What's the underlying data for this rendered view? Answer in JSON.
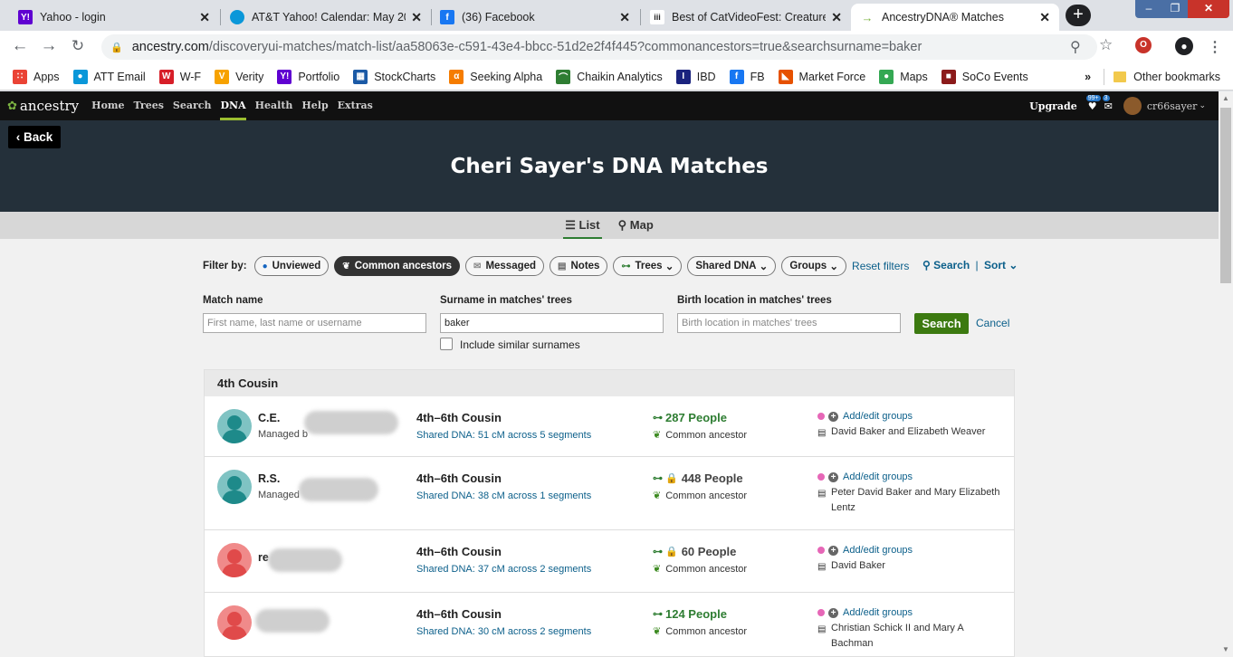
{
  "browser": {
    "tabs": [
      {
        "title": "Yahoo - login",
        "fav": "Y!",
        "fav_color": "#5f01d1"
      },
      {
        "title": "AT&T Yahoo! Calendar: May 202",
        "fav": "●",
        "fav_color": "#0a97d9"
      },
      {
        "title": "(36) Facebook",
        "fav": "f",
        "fav_color": "#1877f2"
      },
      {
        "title": "Best of CatVideoFest: Creature C",
        "fav": "iii",
        "fav_color": "#222"
      },
      {
        "title": "AncestryDNA® Matches",
        "fav": "→",
        "fav_color": "#7cb342"
      }
    ],
    "url_domain": "ancestry.com",
    "url_path": "/discoveryui-matches/match-list/aa58063e-c591-43e4-bbcc-51d2e2f4f445?commonancestors=true&searchsurname=baker",
    "bookmarks": [
      {
        "label": "Apps",
        "icon": "apps-icon",
        "color": "#ea4335",
        "glyph": "∷"
      },
      {
        "label": "ATT Email",
        "icon": "att-globe-icon",
        "color": "#0a97d9",
        "glyph": "●"
      },
      {
        "label": "W-F",
        "icon": "wells-fargo-icon",
        "color": "#d71e28",
        "glyph": "W"
      },
      {
        "label": "Verity",
        "icon": "verity-icon",
        "color": "#f7a200",
        "glyph": "V"
      },
      {
        "label": "Portfolio",
        "icon": "yahoo-icon",
        "color": "#5f01d1",
        "glyph": "Y!"
      },
      {
        "label": "StockCharts",
        "icon": "stockcharts-icon",
        "color": "#1b5aa6",
        "glyph": "▦"
      },
      {
        "label": "Seeking Alpha",
        "icon": "seeking-alpha-icon",
        "color": "#f57c00",
        "glyph": "α"
      },
      {
        "label": "Chaikin Analytics",
        "icon": "chaikin-icon",
        "color": "#2e7d32",
        "glyph": "⌒"
      },
      {
        "label": "IBD",
        "icon": "ibd-icon",
        "color": "#1a237e",
        "glyph": "I"
      },
      {
        "label": "FB",
        "icon": "facebook-icon",
        "color": "#1877f2",
        "glyph": "f"
      },
      {
        "label": "Market Force",
        "icon": "market-force-icon",
        "color": "#e65100",
        "glyph": "◣"
      },
      {
        "label": "Maps",
        "icon": "maps-pin-icon",
        "color": "#34a853",
        "glyph": "●"
      },
      {
        "label": "SoCo Events",
        "icon": "soco-icon",
        "color": "#8b1a1a",
        "glyph": "■"
      }
    ],
    "other_bookmarks": "Other bookmarks",
    "more_chevrons": "»"
  },
  "site": {
    "nav": [
      "Home",
      "Trees",
      "Search",
      "DNA",
      "Health",
      "Help",
      "Extras"
    ],
    "logo": "ancestry",
    "upgrade": "Upgrade",
    "badge_hints": "99+",
    "badge_messages": "3",
    "username": "cr66sayer",
    "back": "Back",
    "title": "Cheri Sayer's DNA Matches",
    "view_list": "List",
    "view_map": "Map"
  },
  "filters": {
    "label": "Filter by:",
    "chips": [
      "Unviewed",
      "Common ancestors",
      "Messaged",
      "Notes",
      "Trees",
      "Shared DNA",
      "Groups"
    ],
    "reset": "Reset filters",
    "search": "Search",
    "sort": "Sort",
    "divider": "|"
  },
  "form": {
    "match_name_label": "Match name",
    "match_name_placeholder": "First name, last name or username",
    "surname_label": "Surname in matches' trees",
    "surname_value": "baker",
    "birth_label": "Birth location in matches' trees",
    "birth_placeholder": "Birth location in matches' trees",
    "similar": "Include similar surnames",
    "search_btn": "Search",
    "cancel": "Cancel"
  },
  "group_title": "4th Cousin",
  "matches": [
    {
      "name": "C.E.",
      "managed": "Managed b",
      "avatar": "teal",
      "relationship": "4th–6th Cousin",
      "shared": "Shared DNA: 51 cM across 5 segments",
      "people": "287 People",
      "locked": false,
      "common": "Common ancestor",
      "groups": "Add/edit groups",
      "ancestors": "David Baker and Elizabeth Weaver"
    },
    {
      "name": "R.S.",
      "managed": "Managed",
      "avatar": "teal",
      "relationship": "4th–6th Cousin",
      "shared": "Shared DNA: 38 cM across 1 segments",
      "people": "448 People",
      "locked": true,
      "common": "Common ancestor",
      "groups": "Add/edit groups",
      "ancestors": "Peter David Baker and Mary Elizabeth Lentz"
    },
    {
      "name": "re",
      "managed": "",
      "avatar": "red",
      "relationship": "4th–6th Cousin",
      "shared": "Shared DNA: 37 cM across 2 segments",
      "people": "60 People",
      "locked": true,
      "common": "Common ancestor",
      "groups": "Add/edit groups",
      "ancestors": "David Baker"
    },
    {
      "name": "",
      "managed": "",
      "avatar": "red",
      "relationship": "4th–6th Cousin",
      "shared": "Shared DNA: 30 cM across 2 segments",
      "people": "124 People",
      "locked": false,
      "common": "Common ancestor",
      "groups": "Add/edit groups",
      "ancestors": "Christian Schick II and Mary A Bachman"
    }
  ],
  "colors": {
    "accent_green": "#3c7a10",
    "link": "#0b5f8a",
    "teal_avatar": "#1e8a8a",
    "red_avatar": "#e04a4a"
  }
}
